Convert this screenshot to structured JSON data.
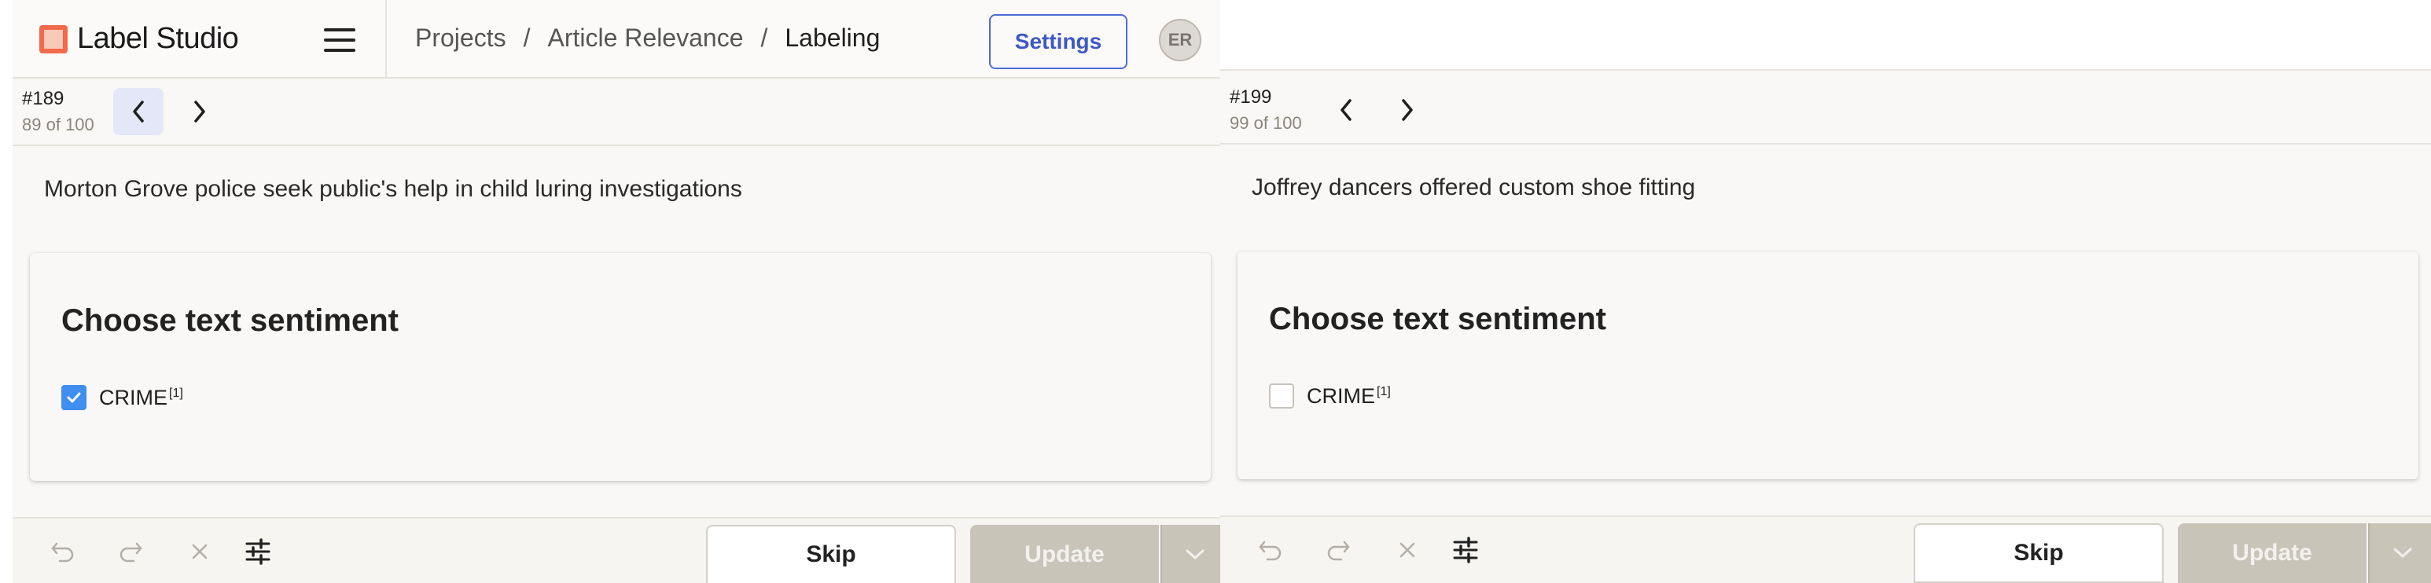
{
  "app": {
    "logo_text": "Label Studio",
    "settings_label": "Settings",
    "avatar_initials": "ER",
    "breadcrumb": [
      "Projects",
      "Article Relevance",
      "Labeling"
    ],
    "breadcrumb_separator": "/"
  },
  "colors": {
    "accent": "#4f6ad6",
    "logo": "#f26a4b",
    "checkbox_checked": "#3f8ef0",
    "update_disabled": "#c9c4b8"
  },
  "left": {
    "task_id": "#189",
    "task_count": "89 of 100",
    "article_text": "Morton Grove police seek public's help in child luring investigations",
    "card_title": "Choose text sentiment",
    "choice_label": "CRIME",
    "choice_hotkey": "[1]",
    "choice_checked": true,
    "skip_label": "Skip",
    "update_label": "Update"
  },
  "right": {
    "task_id": "#199",
    "task_count": "99 of 100",
    "article_text": "Joffrey dancers offered custom shoe fitting",
    "card_title": "Choose text sentiment",
    "choice_label": "CRIME",
    "choice_hotkey": "[1]",
    "choice_checked": false,
    "skip_label": "Skip",
    "update_label": "Update"
  },
  "icons": {
    "undo": "undo-icon",
    "redo": "redo-icon",
    "reset": "close-icon",
    "settings": "sliders-icon",
    "prev": "chevron-left-icon",
    "next": "chevron-right-icon",
    "menu": "chevron-down-icon"
  }
}
